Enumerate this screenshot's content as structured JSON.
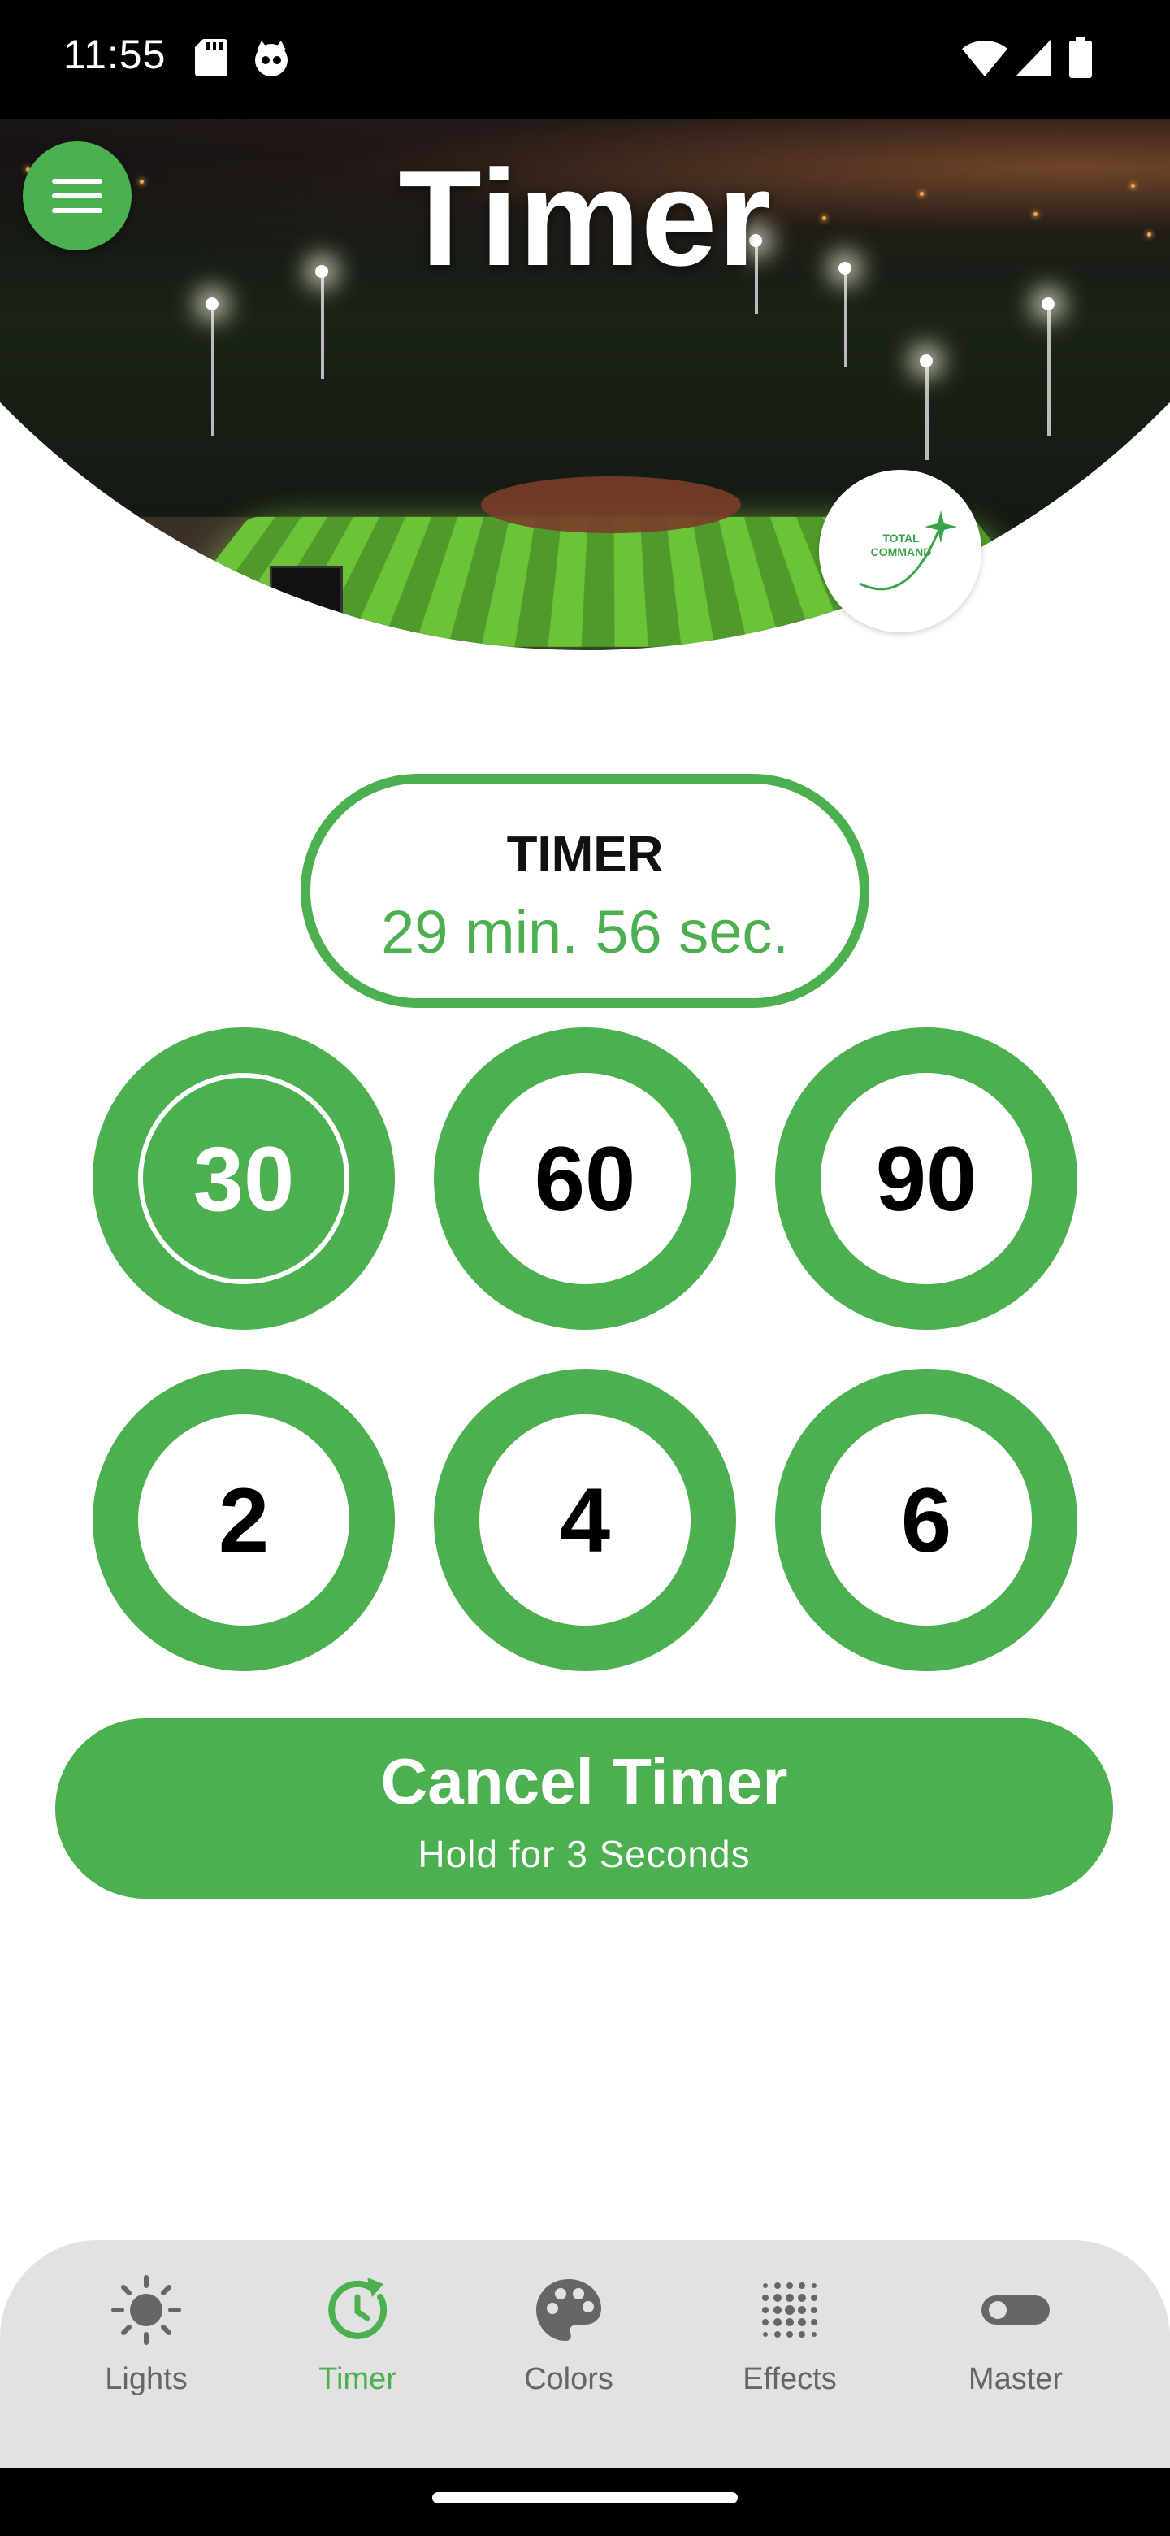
{
  "status_bar": {
    "time": "11:55"
  },
  "header": {
    "title": "Timer",
    "logo_line1": "TOTAL",
    "logo_line2": "COMMAND"
  },
  "timer": {
    "label": "TIMER",
    "value": "29 min. 56 sec."
  },
  "presets": {
    "minutes": [
      {
        "label": "30",
        "selected": true
      },
      {
        "label": "60",
        "selected": false
      },
      {
        "label": "90",
        "selected": false
      }
    ],
    "hours": [
      {
        "label": "2",
        "selected": false
      },
      {
        "label": "4",
        "selected": false
      },
      {
        "label": "6",
        "selected": false
      }
    ]
  },
  "cancel": {
    "label": "Cancel Timer",
    "sublabel": "Hold for 3 Seconds"
  },
  "nav": {
    "items": [
      {
        "label": "Lights",
        "icon": "sun-icon",
        "active": false
      },
      {
        "label": "Timer",
        "icon": "timer-icon",
        "active": true
      },
      {
        "label": "Colors",
        "icon": "palette-icon",
        "active": false
      },
      {
        "label": "Effects",
        "icon": "dots-grid-icon",
        "active": false
      },
      {
        "label": "Master",
        "icon": "toggle-icon",
        "active": false
      }
    ]
  },
  "colors": {
    "accent": "#4caf50",
    "nav_bg": "#e2e2e2",
    "nav_inactive": "#666666"
  }
}
